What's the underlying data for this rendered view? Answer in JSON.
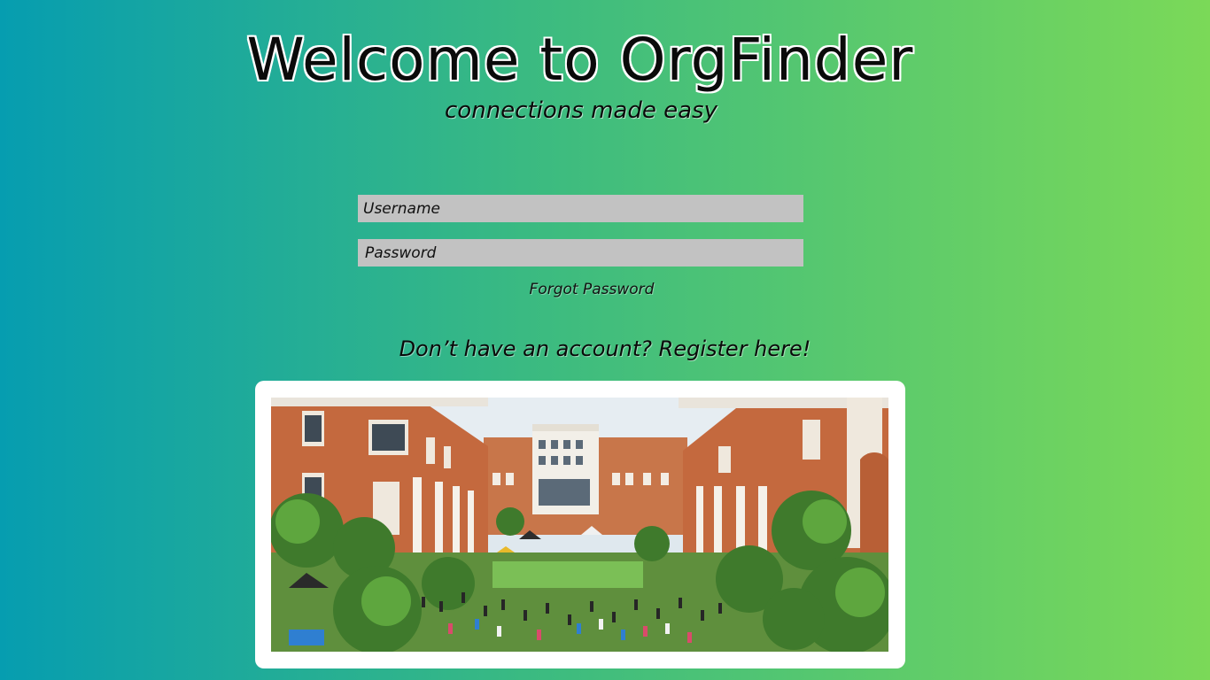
{
  "header": {
    "title": "Welcome to OrgFinder",
    "subtitle": "connections made easy"
  },
  "login_form": {
    "username_placeholder": "Username",
    "password_placeholder": "Password",
    "forgot_password_label": "Forgot Password"
  },
  "register": {
    "label": "Don’t have an account? Register here!"
  },
  "campus_photo": {
    "alt": "campus courtyard crowd photo"
  },
  "colors": {
    "gradient_start": "#069db0",
    "gradient_end": "#7bd958",
    "input_background": "#c2c2c2",
    "photo_frame": "#ffffff"
  }
}
